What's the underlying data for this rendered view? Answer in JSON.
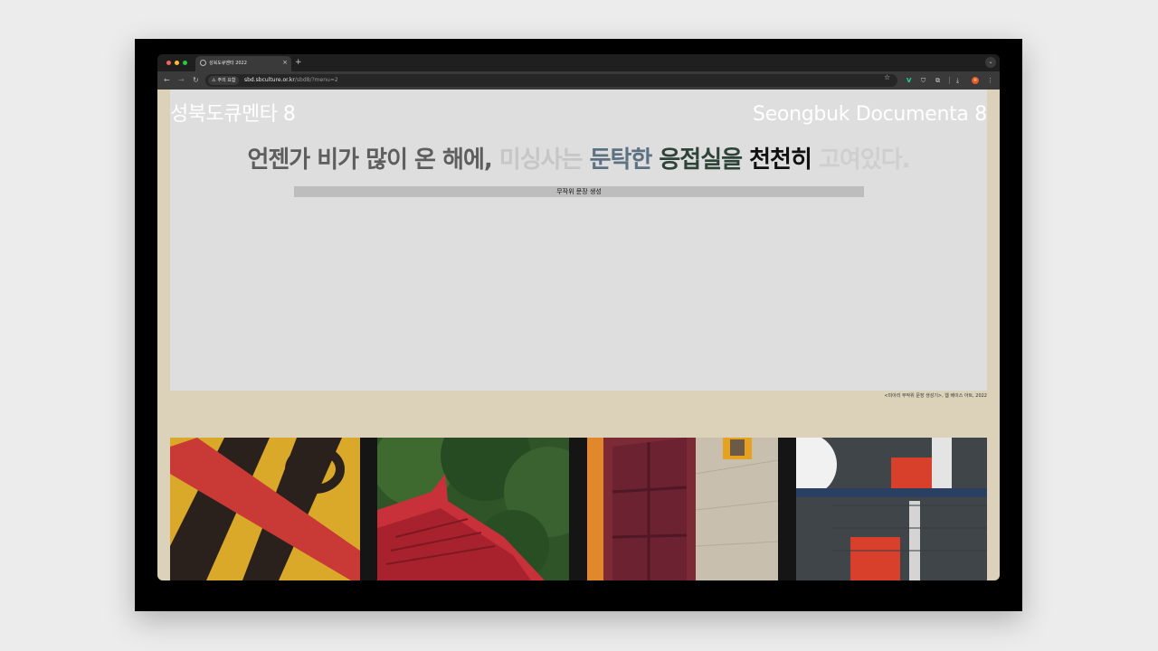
{
  "browser": {
    "tab": {
      "title": "성북도큐멘타 2022",
      "close_glyph": "×"
    },
    "new_tab_glyph": "+",
    "tab_menu_glyph": "⌄",
    "nav": {
      "back_glyph": "←",
      "forward_glyph": "→",
      "reload_glyph": "↻"
    },
    "address_bar": {
      "security_label": "주의 요함",
      "url_host": "sbd.sbculture.or.kr",
      "url_path": "/sbd8/?menu=2"
    },
    "profile_initial": "H",
    "icons": [
      "warning-icon",
      "star-icon",
      "v-extension-icon",
      "shield-extension-icon",
      "puzzle-icon",
      "download-icon",
      "kebab-menu-icon"
    ]
  },
  "page": {
    "title_ko": "성북도큐멘타 8",
    "title_en": "Seongbuk Documenta 8",
    "sentence": {
      "seg1": "언젠가 비가 많이 온 해에,",
      "seg2": "미싱사는",
      "seg3": "둔탁한",
      "seg4": "응접실을",
      "seg5": "천천히",
      "seg6": "고여있다."
    },
    "generate_button": "무작위 문장 생성",
    "caption": "<미아리 무작위 문장 생성기>, 웹 베이스 아트, 2022",
    "colors": {
      "page_background": "#dcd1b9",
      "panel_background": "#dedede",
      "seg1": "#5e5e5e",
      "seg2": "#c6c6c6",
      "seg3": "#5c7182",
      "seg4": "#2e4439",
      "seg5": "#111111",
      "seg6": "#cfcfcf"
    }
  }
}
